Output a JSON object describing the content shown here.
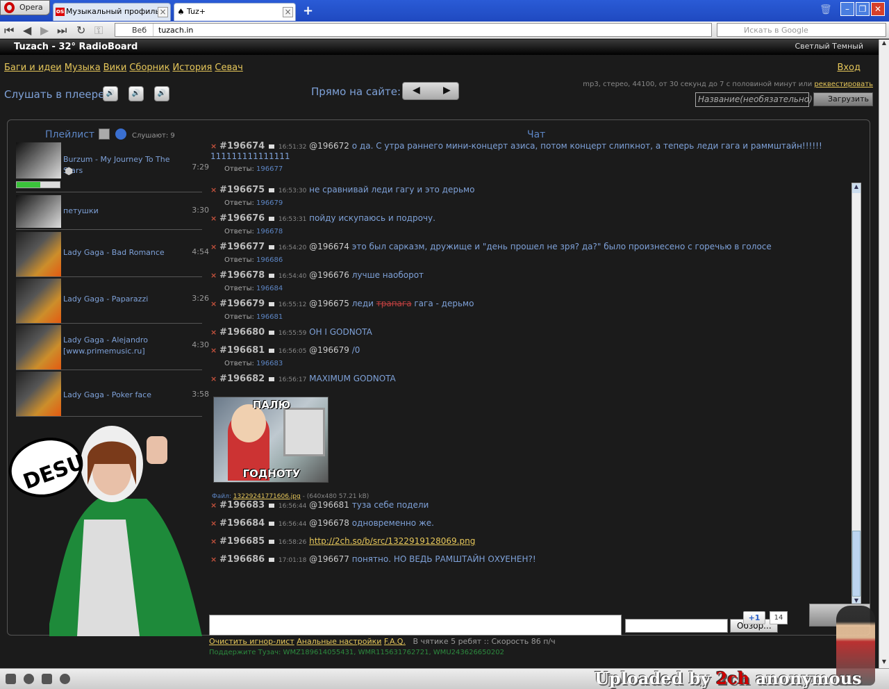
{
  "browser": {
    "menu_label": "Opera",
    "tabs": [
      {
        "label": "Музыкальный профиль...",
        "favicon": "os"
      },
      {
        "label": "Tuz+",
        "favicon": "paw"
      }
    ],
    "web_label": "Веб",
    "url": "tuzach.in",
    "search_placeholder": "Искать в Google"
  },
  "header": {
    "title": "Tuzach - 32° RadioBoard",
    "theme": "Светлый Темный"
  },
  "menu": {
    "items": [
      "Баги и идеи",
      "Музыка",
      "Вики",
      "Сборник",
      "История",
      "Севач"
    ],
    "login": "Вход"
  },
  "player": {
    "listen_label": "Слушать в плеере",
    "direct_label": "Прямо на сайте:",
    "info_prefix": "mp3, стерео, 44100, от 30 секунд до 7 с половиной минут или ",
    "info_link": "реквестировать",
    "name_placeholder": "Название(необязательно)",
    "upload_label": "Загрузить"
  },
  "playlist": {
    "title": "Плейлист",
    "listeners": "Слушают: 9",
    "progress": 0.55,
    "tracks": [
      {
        "name": "Burzum - My Journey To The Stars",
        "duration": "7:29"
      },
      {
        "name": "петушки",
        "duration": "3:30"
      },
      {
        "name": "Lady Gaga - Bad Romance",
        "duration": "4:54"
      },
      {
        "name": "Lady Gaga - Paparazzi",
        "duration": "3:26"
      },
      {
        "name": "Lady Gaga - Alejandro [www.primemusic.ru]",
        "duration": "4:30"
      },
      {
        "name": "Lady Gaga - Poker face",
        "duration": "3:58"
      }
    ]
  },
  "desu_text": "DESU",
  "chat": {
    "title": "Чат",
    "answers_label": "Ответы:",
    "messages": [
      {
        "num": "#196674",
        "time": "16:51:32",
        "ref": "@196672",
        "text": "о да. С утра раннего мини-концерт азиса, потом концерт слипкнот, а теперь леди гага и раммштайн!!!!!! 111111111111111",
        "answers": "196677"
      },
      {
        "num": "#196675",
        "time": "16:53:30",
        "ref": "",
        "text": "не сравнивай леди гагу и это дерьмо",
        "answers": "196679"
      },
      {
        "num": "#196676",
        "time": "16:53:31",
        "ref": "",
        "text": "пойду искупаюсь и подрочу.",
        "answers": "196678"
      },
      {
        "num": "#196677",
        "time": "16:54:20",
        "ref": "@196674",
        "text": "это был сарказм, дружище и \"день прошел не зря? да?\" было произнесено с горечью в голосе",
        "answers": "196686"
      },
      {
        "num": "#196678",
        "time": "16:54:40",
        "ref": "@196676",
        "text": "лучше наоборот",
        "answers": "196684"
      },
      {
        "num": "#196679",
        "time": "16:55:12",
        "ref": "@196675",
        "text_pre": "леди ",
        "text_strike": "трапага",
        "text_post": " гага - дерьмо",
        "answers": "196681"
      },
      {
        "num": "#196680",
        "time": "16:55:59",
        "ref": "",
        "text": "OH I GODNOTA",
        "answers": ""
      },
      {
        "num": "#196681",
        "time": "16:56:05",
        "ref": "@196679",
        "text": "/0",
        "answers": "196683"
      },
      {
        "num": "#196682",
        "time": "16:56:17",
        "ref": "",
        "text": "MAXIMUM GODNOTA",
        "answers": ""
      },
      {
        "num": "#196683",
        "time": "16:56:44",
        "ref": "@196681",
        "text": "туза себе подели",
        "answers": ""
      },
      {
        "num": "#196684",
        "time": "16:56:44",
        "ref": "@196678",
        "text": "одновременно же.",
        "answers": ""
      },
      {
        "num": "#196685",
        "time": "16:58:26",
        "ref": "",
        "link": "http://2ch.so/b/src/1322919128069.png",
        "answers": ""
      },
      {
        "num": "#196686",
        "time": "17:01:18",
        "ref": "@196677",
        "text": "понятно. НО ВЕДЬ РАМШТАЙН ОХУЕНЕН?!",
        "answers": ""
      }
    ],
    "image": {
      "top_text": "ПАЛЮ",
      "bottom_text": "ГОДНОТУ"
    },
    "file_label": "Файл:",
    "file_name": "13229241771606.jpg",
    "file_meta": " - (640x480 57.21 kB)"
  },
  "footer": {
    "browse_label": "Обзор...",
    "links": [
      "Очистить игнор-лист",
      "Анальные настройки",
      "F.A.Q."
    ],
    "stats": "В чятике 5 ребят :: Скорость 86 п/ч",
    "support": "Поддержите Тузач: WMZ189614055431, WMR115631762721, WMU243626650202",
    "plus_label": "+1",
    "plus_count": "14"
  },
  "watermark": {
    "pre": "Uploaded by ",
    "red": "2ch",
    "post": " anonymous"
  }
}
